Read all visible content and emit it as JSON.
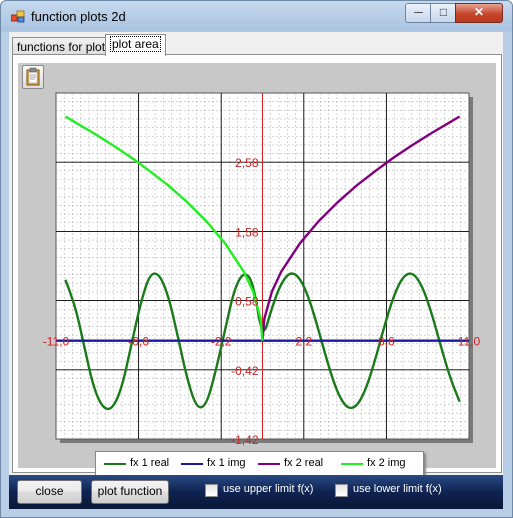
{
  "window": {
    "title": "function plots 2d"
  },
  "titlebar_controls": {
    "minimize": "─",
    "maximize": "□",
    "close": "✕"
  },
  "tabs": [
    {
      "label": "functions for plot",
      "selected": false
    },
    {
      "label": "plot area",
      "selected": true
    }
  ],
  "toolbar": {
    "clipboard_icon": "clipboard-icon"
  },
  "chart_data": {
    "type": "line",
    "xlim": [
      -11.0,
      11.0
    ],
    "ylim": [
      -1.42,
      3.58
    ],
    "x_tick_labels": [
      "-11,0",
      "-6,6",
      "-2,2",
      "2,2",
      "6,6",
      "11,0"
    ],
    "x_ticks": [
      -11.0,
      -6.6,
      -2.2,
      2.2,
      6.6,
      11.0
    ],
    "y_tick_labels": [
      "-1,42",
      "-0,42",
      "0,58",
      "1,58",
      "2,58"
    ],
    "y_ticks": [
      -1.42,
      -0.42,
      0.58,
      1.58,
      2.58
    ],
    "grid": true,
    "axis_color": "#cc2222",
    "series": [
      {
        "name": "fx 1 real",
        "color": "#1a7a1a",
        "x": [
          -10.5,
          -10.0,
          -9.5,
          -9.0,
          -8.5,
          -8.0,
          -7.5,
          -7.0,
          -6.5,
          -6.0,
          -5.5,
          -5.0,
          -4.5,
          -4.0,
          -3.5,
          -3.0,
          -2.5,
          -2.0,
          -1.5,
          -1.0,
          -0.5,
          0.0,
          0.5,
          1.0,
          1.5,
          2.0,
          2.5,
          3.0,
          3.5,
          4.0,
          4.5,
          5.0,
          5.5,
          6.0,
          6.5,
          7.0,
          7.5,
          8.0,
          8.5,
          9.0,
          9.5,
          10.0,
          10.5
        ],
        "y": [
          0.88,
          0.54,
          -0.08,
          -0.68,
          -0.98,
          -0.99,
          -0.69,
          -0.08,
          0.54,
          0.97,
          0.97,
          0.64,
          0.05,
          -0.57,
          -0.98,
          -0.94,
          -0.45,
          0.15,
          0.75,
          1.0,
          0.86,
          0.0,
          0.48,
          0.84,
          1.0,
          0.91,
          0.6,
          0.14,
          -0.35,
          -0.76,
          -0.98,
          -0.96,
          -0.71,
          -0.28,
          0.22,
          0.66,
          0.94,
          0.99,
          0.8,
          0.41,
          -0.08,
          -0.54,
          -0.88
        ]
      },
      {
        "name": "fx 1 img",
        "color": "#1a1aa0",
        "x": [
          -11.0,
          11.0
        ],
        "y": [
          0,
          0
        ]
      },
      {
        "name": "fx 2 real",
        "color": "#800080",
        "x": [
          0.0,
          0.1,
          0.5,
          1,
          2,
          3,
          4,
          5,
          6,
          7,
          8,
          9,
          10,
          10.5
        ],
        "y": [
          0.0,
          0.32,
          0.71,
          1.0,
          1.41,
          1.73,
          2.0,
          2.24,
          2.45,
          2.65,
          2.83,
          3.0,
          3.16,
          3.24
        ]
      },
      {
        "name": "fx 2 img",
        "color": "#22ee22",
        "x": [
          -10.5,
          -10,
          -9,
          -8,
          -7,
          -6,
          -5,
          -4,
          -3,
          -2,
          -1,
          -0.5,
          -0.1,
          0.0
        ],
        "y": [
          3.24,
          3.16,
          3.0,
          2.83,
          2.65,
          2.45,
          2.24,
          2.0,
          1.73,
          1.41,
          1.0,
          0.71,
          0.32,
          0.0
        ]
      }
    ]
  },
  "legend": [
    {
      "label": "fx 1 real",
      "color": "#1a7a1a"
    },
    {
      "label": "fx 1 img",
      "color": "#1a1aa0"
    },
    {
      "label": "fx 2 real",
      "color": "#800080"
    },
    {
      "label": "fx 2 img",
      "color": "#22ee22"
    }
  ],
  "bottom": {
    "close_label": "close",
    "plot_label": "plot function",
    "upper_limit_label": "use upper limit f(x)",
    "upper_limit_checked": false,
    "lower_limit_label": "use lower limit f(x)",
    "lower_limit_checked": false
  }
}
